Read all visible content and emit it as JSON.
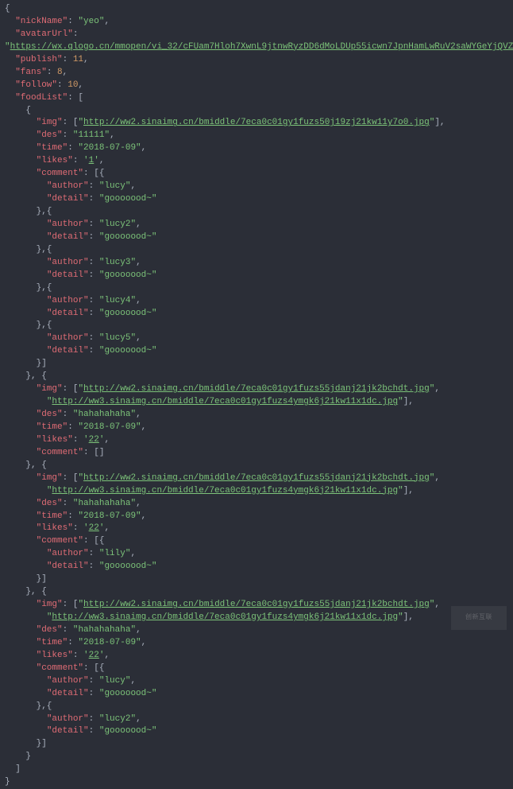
{
  "nickName": "yeo",
  "avatarUrl": "https://wx.qlogo.cn/mmopen/vi_32/cFUam7Hloh7XwnL9jtnwRyzDD6dMoLDUp55icwn7JpnHamLwRuV2saWYGeYjQVZK0rs209gk2dr4aaH0p40wbow/132",
  "publish": 11,
  "fans": 8,
  "follow": 10,
  "foodList": [
    {
      "img": [
        "http://ww2.sinaimg.cn/bmiddle/7eca0c01gy1fuzs50j19zj21kw11y7o0.jpg"
      ],
      "des": "11111",
      "time": "2018-07-09",
      "likes": "1",
      "comment": [
        {
          "author": "lucy",
          "detail": "gooooood~"
        },
        {
          "author": "lucy2",
          "detail": "gooooood~"
        },
        {
          "author": "lucy3",
          "detail": "gooooood~"
        },
        {
          "author": "lucy4",
          "detail": "gooooood~"
        },
        {
          "author": "lucy5",
          "detail": "gooooood~"
        }
      ]
    },
    {
      "img": [
        "http://ww2.sinaimg.cn/bmiddle/7eca0c01gy1fuzs55jdanj21jk2bchdt.jpg",
        "http://ww3.sinaimg.cn/bmiddle/7eca0c01gy1fuzs4ymgk6j21kw11x1dc.jpg"
      ],
      "des": "hahahahaha",
      "time": "2018-07-09",
      "likes": "22",
      "comment": []
    },
    {
      "img": [
        "http://ww2.sinaimg.cn/bmiddle/7eca0c01gy1fuzs55jdanj21jk2bchdt.jpg",
        "http://ww3.sinaimg.cn/bmiddle/7eca0c01gy1fuzs4ymgk6j21kw11x1dc.jpg"
      ],
      "des": "hahahahaha",
      "time": "2018-07-09",
      "likes": "22",
      "comment": [
        {
          "author": "lily",
          "detail": "gooooood~"
        }
      ]
    },
    {
      "img": [
        "http://ww2.sinaimg.cn/bmiddle/7eca0c01gy1fuzs55jdanj21jk2bchdt.jpg",
        "http://ww3.sinaimg.cn/bmiddle/7eca0c01gy1fuzs4ymgk6j21kw11x1dc.jpg"
      ],
      "des": "hahahahaha",
      "time": "2018-07-09",
      "likes": "22",
      "comment": [
        {
          "author": "lucy",
          "detail": "gooooood~"
        },
        {
          "author": "lucy2",
          "detail": "gooooood~"
        }
      ]
    }
  ],
  "watermark": "创新互联"
}
